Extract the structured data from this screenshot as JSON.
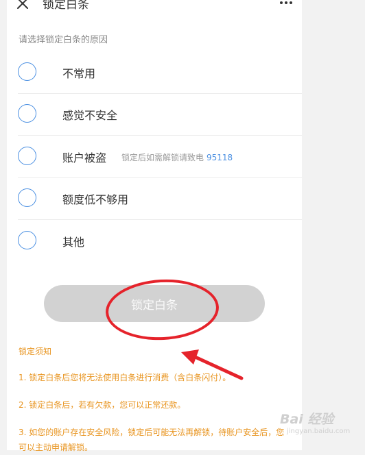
{
  "header": {
    "title": "锁定白条"
  },
  "section_hint": "请选择锁定白条的原因",
  "options": [
    {
      "label": "不常用"
    },
    {
      "label": "感觉不安全"
    },
    {
      "label": "账户被盗",
      "note": "锁定后如需解锁请致电",
      "phone": "95118"
    },
    {
      "label": "额度低不够用"
    },
    {
      "label": "其他"
    }
  ],
  "lock_button": {
    "label": "锁定白条"
  },
  "notice": {
    "title": "锁定须知",
    "items": [
      "1. 锁定白条后您将无法使用白条进行消费（含白条闪付）。",
      "2. 锁定白条后，若有欠款，您可以正常还款。",
      "3. 如您的账户存在安全风险，锁定后可能无法再解锁，待账户安全后，您可以主动申请解锁。"
    ]
  },
  "watermark": {
    "logo": "Bai 经验",
    "url": "jingyan.baidu.com"
  },
  "colors": {
    "accent": "#4a8fe2",
    "notice": "#e8941f",
    "annotation": "#e5232b"
  }
}
